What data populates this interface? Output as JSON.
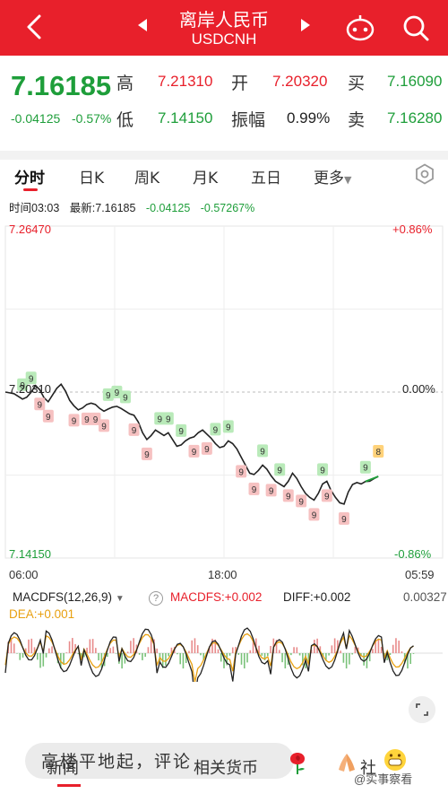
{
  "header": {
    "title": "离岸人民币",
    "subtitle": "USDCNH"
  },
  "quote": {
    "price": "7.16185",
    "change": "-0.04125",
    "change_pct": "-0.57%",
    "high_label": "高",
    "high": "7.21310",
    "open_label": "开",
    "open": "7.20320",
    "buy_label": "买",
    "buy": "7.16090",
    "low_label": "低",
    "low": "7.14150",
    "amp_label": "振幅",
    "amp": "0.99%",
    "sell_label": "卖",
    "sell": "7.16280"
  },
  "tabs": [
    {
      "label": "分时",
      "active": true
    },
    {
      "label": "日K"
    },
    {
      "label": "周K"
    },
    {
      "label": "月K"
    },
    {
      "label": "五日"
    },
    {
      "label": "更多"
    }
  ],
  "info_bar": {
    "time": "时间03:03",
    "latest": "最新:7.16185",
    "change": "-0.04125",
    "change_pct": "-0.57267%"
  },
  "chart_data": {
    "type": "line",
    "y_top": "7.26470",
    "y_top_pct": "+0.86%",
    "y_mid": "7.20310",
    "y_mid_pct": "0.00%",
    "y_bottom": "7.14150",
    "y_bottom_pct": "-0.86%",
    "ylim": [
      7.1415,
      7.2647
    ],
    "x_ticks": [
      "06:00",
      "18:00",
      "05:59"
    ],
    "series": [
      {
        "values": [
          7.2031,
          7.2028,
          7.2025,
          7.2015,
          7.2005,
          7.2012,
          7.203,
          7.2055,
          7.204,
          7.201,
          7.1995,
          7.202,
          7.2045,
          7.206,
          7.2035,
          7.2,
          7.198,
          7.1965,
          7.1972,
          7.1985,
          7.199,
          7.1985,
          7.197,
          7.196,
          7.1968,
          7.1975,
          7.1978,
          7.197,
          7.196,
          7.195,
          7.1945,
          7.192,
          7.188,
          7.1855,
          7.187,
          7.189,
          7.188,
          7.187,
          7.188,
          7.1855,
          7.183,
          7.1835,
          7.185,
          7.186,
          7.1865,
          7.188,
          7.189,
          7.1875,
          7.186,
          7.184,
          7.1825,
          7.183,
          7.185,
          7.184,
          7.182,
          7.179,
          7.176,
          7.173,
          7.1725,
          7.174,
          7.176,
          7.1745,
          7.172,
          7.17,
          7.169,
          7.168,
          7.17,
          7.173,
          7.171,
          7.168,
          7.1655,
          7.164,
          7.163,
          7.1655,
          7.169,
          7.17,
          7.1665,
          7.164,
          7.162,
          7.1615,
          7.166,
          7.1688,
          7.1695,
          7.169,
          7.1699,
          7.17,
          7.171,
          7.1718
        ]
      }
    ]
  },
  "macd": {
    "selector": "MACDFS(12,26,9)",
    "macdfs": "MACDFS:+0.002",
    "diff": "DIFF:+0.002",
    "dea": "DEA:+0.001",
    "max": "0.00327",
    "help": "?"
  },
  "markers_nine": [
    "9"
  ],
  "marker_eight": "8",
  "bottom": {
    "ticker": "高楼平地起，评论",
    "tab_news": "新闻",
    "tab_currency": "相关货币",
    "tab_community": "社",
    "watermark": "@实事察看"
  },
  "colors": {
    "accent_red": "#e8202b",
    "accent_green": "#1e9e3a",
    "line": "#222222"
  }
}
